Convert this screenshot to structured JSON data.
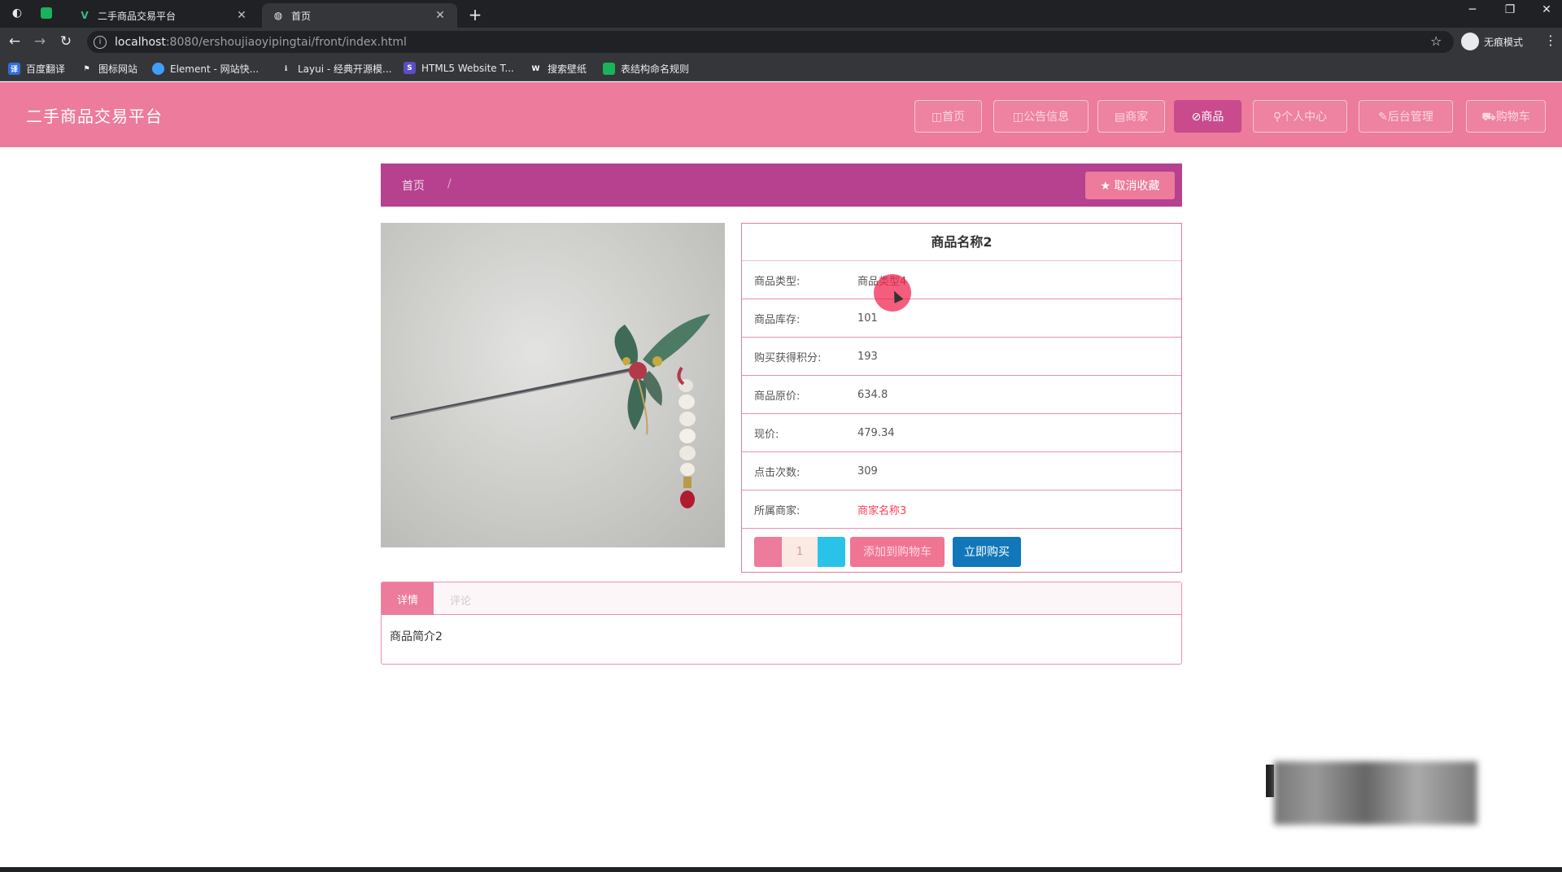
{
  "browser": {
    "tabs": [
      {
        "title": "二手商品交易平台",
        "active": false
      },
      {
        "title": "首页",
        "active": true
      }
    ],
    "new_tab": "+",
    "url_host": "localhost",
    "url_path": ":8080/ershoujiaoyipingtai/front/index.html",
    "profile_label": "无痕模式",
    "bookmarks": [
      "百度翻译",
      "图标网站",
      "Element - 网站快...",
      "Layui - 经典开源模...",
      "HTML5 Website T...",
      "搜索壁纸",
      "表结构命名规则"
    ]
  },
  "header": {
    "site_title": "二手商品交易平台",
    "nav": [
      {
        "label": "◫首页",
        "active": false
      },
      {
        "label": "◫公告信息",
        "active": false
      },
      {
        "label": "▤商家",
        "active": false
      },
      {
        "label": "⊘商品",
        "active": true
      },
      {
        "label": "⚲个人中心",
        "active": false
      },
      {
        "label": "✎后台管理",
        "active": false
      },
      {
        "label": "⛟购物车",
        "active": false
      }
    ]
  },
  "breadcrumb": {
    "home": "首页",
    "separator": "/",
    "favorite_button": "★ 取消收藏"
  },
  "product": {
    "name": "商品名称2",
    "fields": [
      {
        "label": "商品类型:",
        "value": "商品类型4",
        "highlight": false
      },
      {
        "label": "商品库存:",
        "value": "101",
        "highlight": false
      },
      {
        "label": "购买获得积分:",
        "value": "193",
        "highlight": false
      },
      {
        "label": "商品原价:",
        "value": "634.8",
        "highlight": false
      },
      {
        "label": "现价:",
        "value": "479.34",
        "highlight": false
      },
      {
        "label": "点击次数:",
        "value": "309",
        "highlight": false
      },
      {
        "label": "所属商家:",
        "value": "商家名称3",
        "highlight": true
      }
    ],
    "quantity": "1",
    "add_to_cart": "添加到购物车",
    "buy_now": "立即购买"
  },
  "tabs": {
    "detail_label": "详情",
    "review_label": "评论",
    "content": "商品简介2"
  },
  "colors": {
    "header_pink": "#ec7b9c",
    "breadcrumb_purple": "#b5418f",
    "buy_blue": "#1177b9",
    "plus_cyan": "#29c3ea"
  }
}
